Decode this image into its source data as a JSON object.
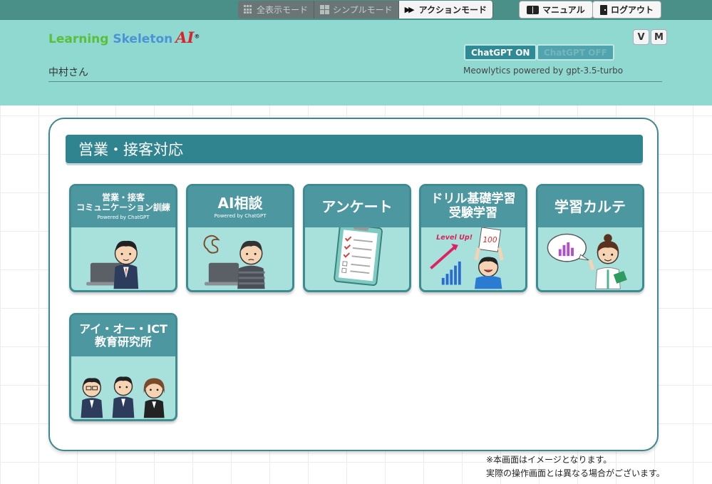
{
  "modes": [
    {
      "label": "全表示モード",
      "icon": "grid-icon",
      "active": false
    },
    {
      "label": "シンプルモード",
      "icon": "grid-large-icon",
      "active": false
    },
    {
      "label": "アクションモード",
      "icon": "fast-forward-icon",
      "active": true
    }
  ],
  "utility": {
    "manual_label": "マニュアル",
    "logout_label": "ログアウト"
  },
  "header": {
    "logo": {
      "part1": "Learning",
      "part2": "Skeleton",
      "ai": "AI",
      "mark": "®"
    },
    "username": "中村さん",
    "v_label": "V",
    "m_label": "M",
    "chatgpt_on_label": "ChatGPT ON",
    "chatgpt_off_label": "ChatGPT OFF",
    "powered_by": "Meowlytics powered by gpt-3.5-turbo"
  },
  "section": {
    "title": "営業・接客対応"
  },
  "tiles": [
    {
      "title_line1": "営業・接客",
      "title_line2": "コミュニケーション訓練",
      "sub": "Powered by ChatGPT",
      "icon": "salesperson-laptop-icon"
    },
    {
      "title_line1": "AI相談",
      "title_line2": "",
      "sub": "Powered by ChatGPT",
      "icon": "worried-person-laptop-icon"
    },
    {
      "title_line1": "アンケート",
      "title_line2": "",
      "sub": "",
      "icon": "clipboard-checklist-icon"
    },
    {
      "title_line1": "ドリル基礎学習",
      "title_line2": "受験学習",
      "sub": "",
      "icon": "level-up-student-icon"
    },
    {
      "title_line1": "学習カルテ",
      "title_line2": "",
      "sub": "",
      "icon": "teacher-chart-icon"
    },
    {
      "title_line1": "アイ・オー・ICT",
      "title_line2": "教育研究所",
      "sub": "",
      "icon": "three-staff-icon"
    }
  ],
  "level_up_text": "Level Up!",
  "score_text": "100",
  "notes": {
    "line1": "※本画面はイメージとなります。",
    "line2": "実際の操作画面とは異なる場合がございます。"
  },
  "colors": {
    "accent": "#2f8490",
    "header_bg": "#8fd9d1",
    "tile_bg": "#a8e0dc",
    "tile_head": "#4d97a1"
  }
}
